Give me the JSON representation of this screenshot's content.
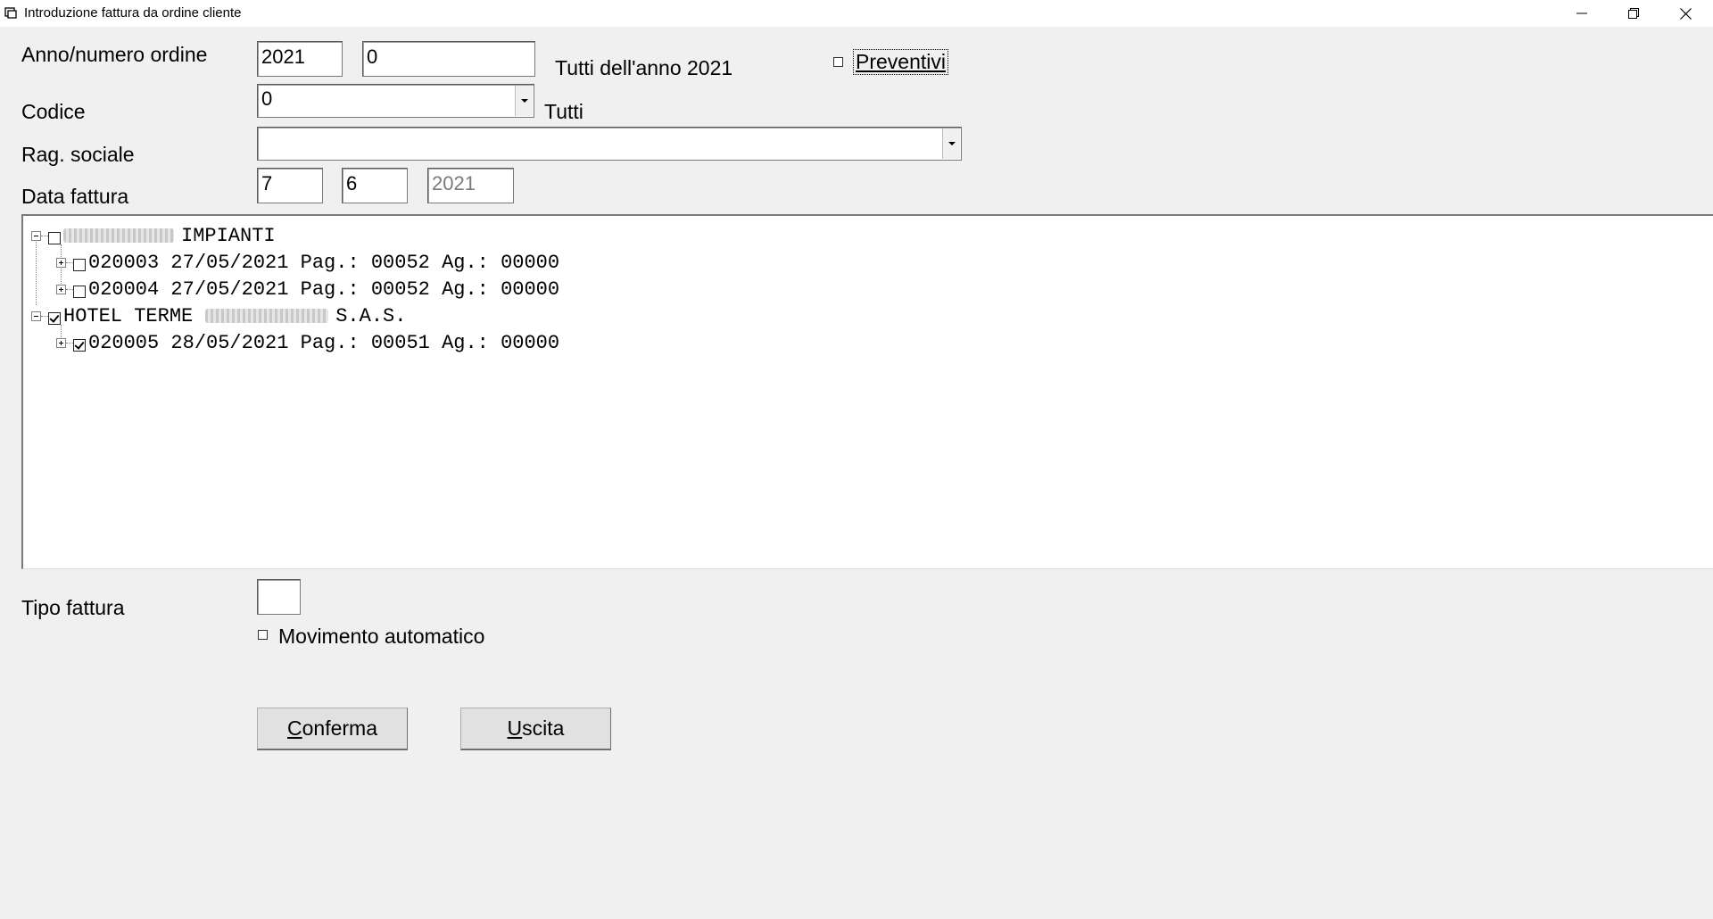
{
  "window": {
    "title": "Introduzione fattura da ordine cliente",
    "minimize_glyph": "minimize-icon",
    "restore_glyph": "restore-icon",
    "close_glyph": "close-icon"
  },
  "order": {
    "label": "Anno/numero ordine",
    "year_value": "2021",
    "number_value": "0",
    "all_year_text": "Tutti dell'anno 2021",
    "quotes_label": "Preventivi",
    "quotes_checked": false
  },
  "code": {
    "label": "Codice",
    "value": "0",
    "all_text": "Tutti"
  },
  "company": {
    "label": "Rag. sociale",
    "value": ""
  },
  "invoice_date": {
    "label": "Data fattura",
    "day": "7",
    "month": "6",
    "year": "2021"
  },
  "tree": {
    "nodes": [
      {
        "label": "IMPIANTI",
        "checked": false,
        "expanded": true,
        "children": [
          {
            "label": "020003 27/05/2021 Pag.: 00052 Ag.: 00000",
            "checked": false,
            "expanded": false
          },
          {
            "label": "020004 27/05/2021 Pag.: 00052 Ag.: 00000",
            "checked": false,
            "expanded": false
          }
        ]
      },
      {
        "label_prefix": "HOTEL TERME",
        "label": "S.A.S.",
        "checked": true,
        "expanded": true,
        "children": [
          {
            "label": "020005 28/05/2021 Pag.: 00051 Ag.: 00000",
            "checked": true,
            "expanded": false
          }
        ]
      }
    ]
  },
  "invoice_type": {
    "label": "Tipo fattura",
    "value": "",
    "auto_movement_label": "Movimento automatico",
    "auto_movement_checked": false
  },
  "buttons": {
    "confirm_label": "Conferma",
    "exit_label": "Uscita"
  }
}
